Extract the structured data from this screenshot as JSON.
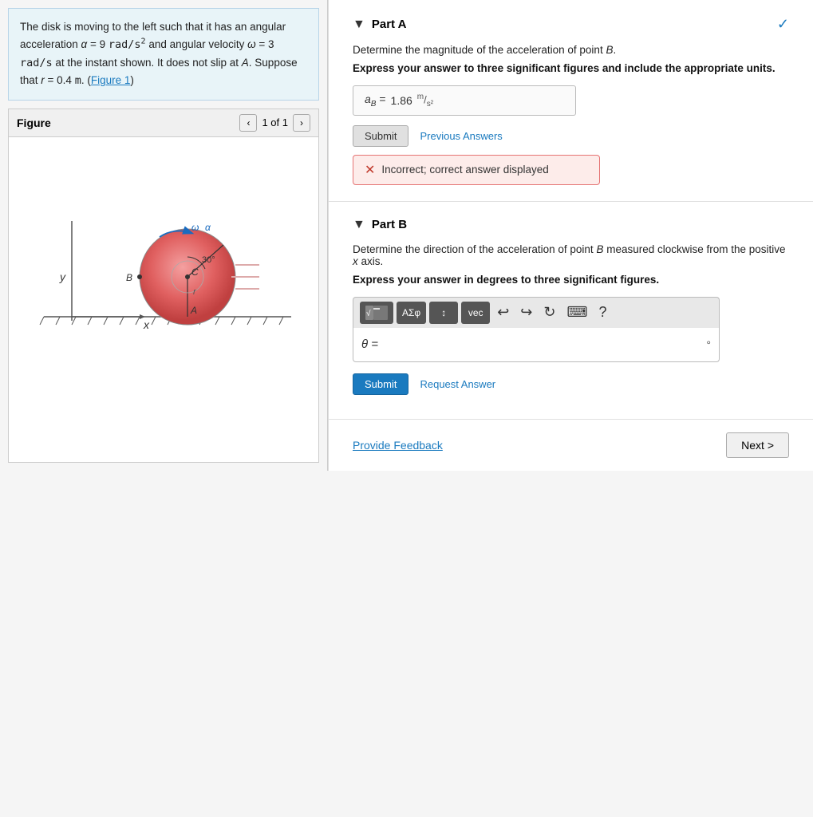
{
  "leftPanel": {
    "description": {
      "line1": "The disk is moving to the left such that it has an angular",
      "line2": "acceleration α = 9 rad/s² and angular velocity",
      "line3": "ω = 3 rad/s at the instant shown. It does not slip at A.",
      "line4": "Suppose that r = 0.4 m. (Figure 1)"
    },
    "figure": {
      "title": "Figure",
      "page": "1 of 1"
    }
  },
  "partA": {
    "label": "Part A",
    "instruction": "Determine the magnitude of the acceleration of point B.",
    "note": "Express your answer to three significant figures and include the appropriate units.",
    "answerLabel": "a_B =",
    "answerValue": "1.86",
    "answerUnit": "m/s²",
    "submitLabel": "Submit",
    "prevAnswersLabel": "Previous Answers",
    "incorrectLabel": "Incorrect; correct answer displayed",
    "checkIcon": "✓"
  },
  "partB": {
    "label": "Part B",
    "instruction": "Determine the direction of the acceleration of point B measured clockwise from the positive x axis.",
    "note": "Express your answer in degrees to three significant figures.",
    "thetaLabel": "θ =",
    "degreeSymbol": "°",
    "submitLabel": "Submit",
    "requestAnswerLabel": "Request Answer",
    "toolbar": {
      "mathBtn": "√[]",
      "symbolBtn": "ΑΣφ",
      "formatBtn": "↕",
      "vectorBtn": "vec",
      "undoBtn": "↩",
      "redoBtn": "↪",
      "refreshBtn": "↻",
      "keyboardBtn": "⌨",
      "helpBtn": "?"
    }
  },
  "footer": {
    "provideFeedbackLabel": "Provide Feedback",
    "nextLabel": "Next >"
  }
}
